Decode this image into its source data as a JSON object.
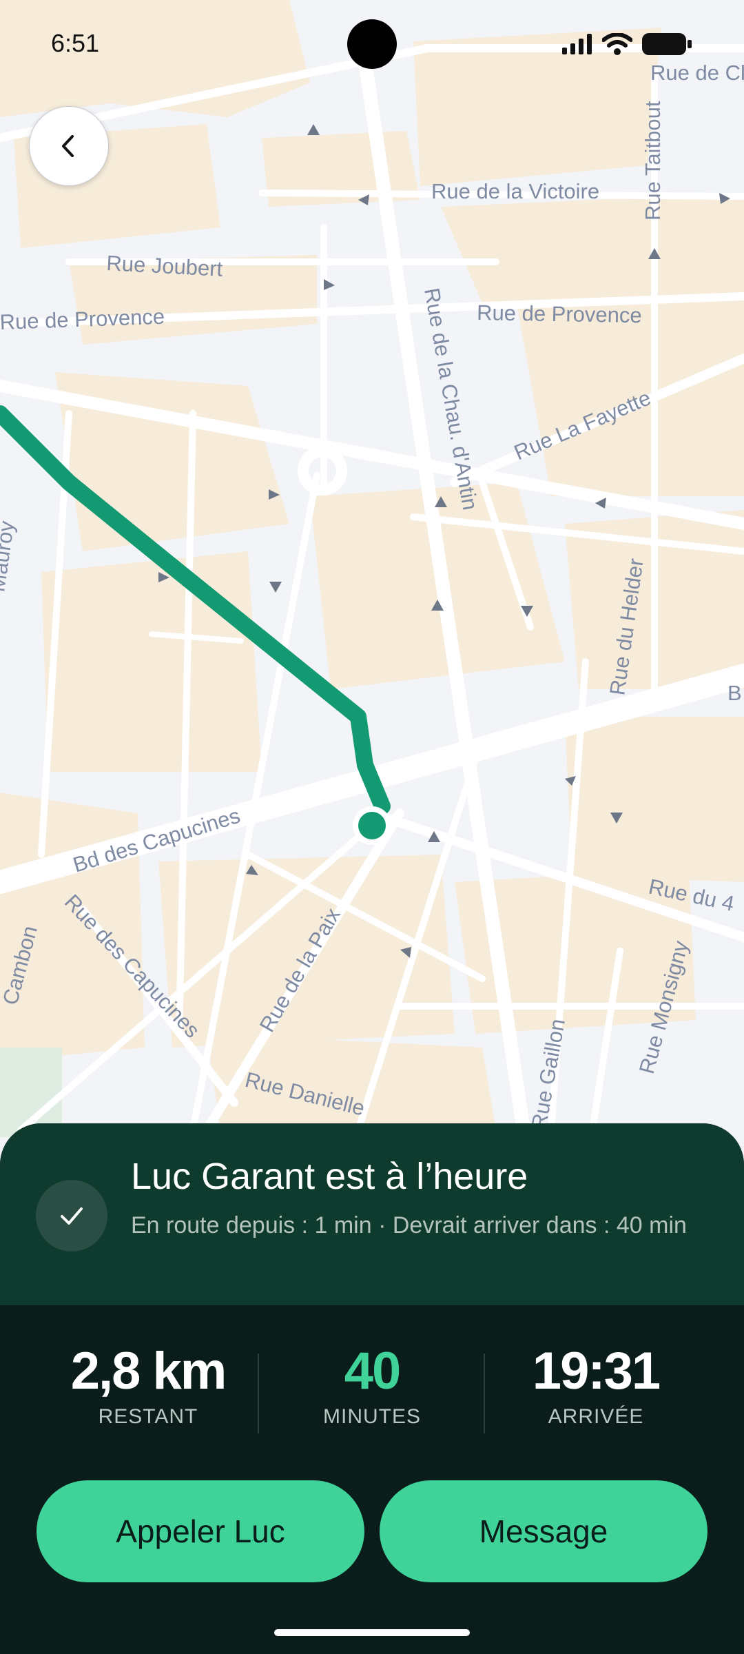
{
  "status_bar": {
    "time": "6:51"
  },
  "map": {
    "street_labels": [
      "Rue de Cl",
      "Rue de la Victoire",
      "Rue Taitbout",
      "Rue Joubert",
      "Rue de Provence",
      "Rue de Provence",
      "Rue de la Chau. d'Antin",
      "Rue La Fayette",
      "Mauroy",
      "Rue du Helder",
      "B",
      "Bd des Capucines",
      "Rue des Capucines",
      "Rue de la Paix",
      "Rue du 4",
      "Rue Monsigny",
      "Rue Gaillon",
      "Rue Danielle",
      "Cambon"
    ],
    "route_color": "#139a72"
  },
  "banner": {
    "title": "Luc Garant est à l’heure",
    "subtitle": "En route depuis : 1 min · Devrait arriver dans : 40 min"
  },
  "stats": [
    {
      "value": "2,8 km",
      "label": "RESTANT"
    },
    {
      "value": "40",
      "label": "MINUTES"
    },
    {
      "value": "19:31",
      "label": "ARRIVÉE"
    }
  ],
  "actions": {
    "call_label": "Appeler Luc",
    "message_label": "Message"
  },
  "colors": {
    "accent": "#3fd39a",
    "sheet_bg": "#0a1d1a",
    "banner_bg": "#0f3b2e"
  }
}
